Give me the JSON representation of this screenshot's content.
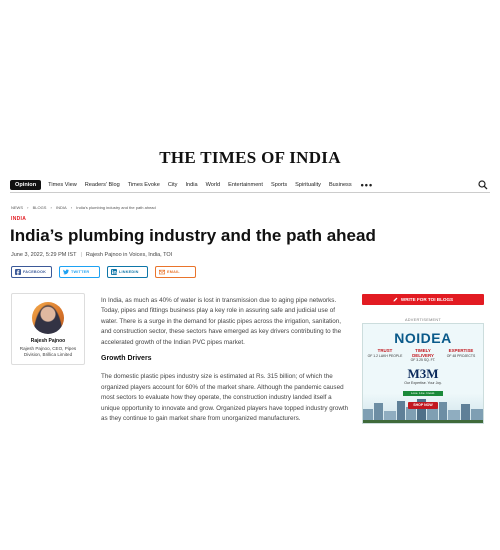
{
  "masthead": "THE TIMES OF INDIA",
  "nav": {
    "opinion": "Opinion",
    "items": [
      "Times View",
      "Readers' Blog",
      "Times Evoke",
      "City",
      "India",
      "World",
      "Entertainment",
      "Sports",
      "Spirituality",
      "Business"
    ],
    "more": "•••"
  },
  "breadcrumbs": [
    "NEWS",
    "›",
    "BLOGS",
    "›",
    "INDIA",
    "›",
    "India's plumbing industry and the path ahead"
  ],
  "article": {
    "section": "INDIA",
    "title": "India’s plumbing industry and the path ahead",
    "date": "June 3, 2022, 5:29 PM IST",
    "byline": "Rajesh Pajnoo in Voices, India, TOI",
    "paragraphs": [
      "In India, as much as 40% of water is lost in transmission due to aging pipe networks. Today, pipes and fittings business play a key role in assuring safe and judicial use of water. There is a surge in the demand for plastic pipes across the irrigation, sanitation, and construction sector, these sectors have emerged as key drivers contributing to the accelerated growth of the Indian PVC pipes market.",
      "The domestic plastic pipes industry size is estimated at Rs. 315 billion; of which the organized players account for 60% of the market share. Although the pandemic caused most sectors to evaluate how they operate, the construction industry landed itself a unique opportunity to innovate and grow. Organized players have topped industry growth as they continue to gain market share from unorganized manufacturers."
    ],
    "subheading": "Growth Drivers"
  },
  "share": {
    "facebook": "FACEBOOK",
    "twitter": "TWITTER",
    "linkedin": "LINKEDIN",
    "email": "EMAIL"
  },
  "author": {
    "name": "Rajesh Pajnoo",
    "role": "Rajesh Pajnoo, CEO, Pipes Division, Brillica Limited"
  },
  "sidebar": {
    "write_label": "WRITE FOR TOI BLOGS",
    "ad_label": "ADVERTISEMENT",
    "ad": {
      "logo": "NOIDEA",
      "col1_title": "TRUST",
      "col1_text": "OF 1.2 LAKH PEOPLE",
      "col2_title": "TIMELY DELIVERY",
      "col2_text": "OF 3.25 SQ. FT.",
      "col3_title": "EXPERTISE",
      "col3_text": "OF 48 PROJECTS",
      "brand": "M3M",
      "tagline_1": "Our Expertise. Your Joy.",
      "tagline_2": "Love. Live. Invest.",
      "shop": "SHOP NOW"
    }
  },
  "colors": {
    "accent_red": "#e21b22",
    "facebook": "#3b5998",
    "twitter": "#1da1f2",
    "linkedin": "#0e76a8",
    "email": "#e9742b"
  }
}
